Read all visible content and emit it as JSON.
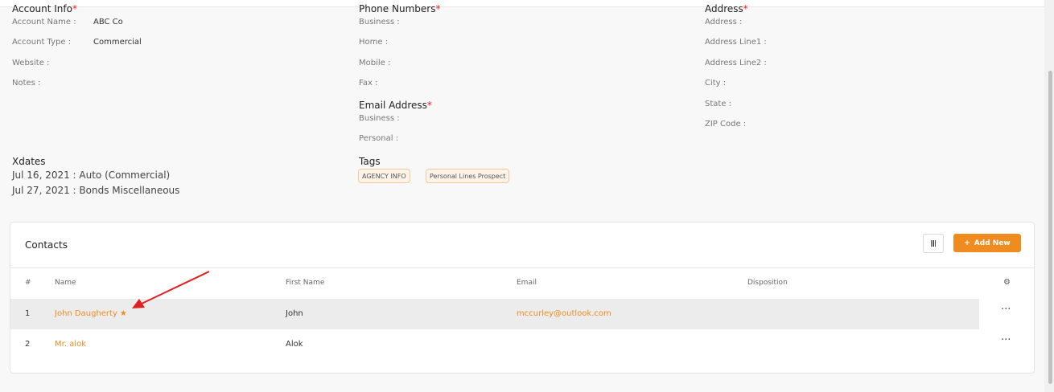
{
  "account_info": {
    "title": "Account Info",
    "required_mark": "*",
    "fields": [
      {
        "label": "Account Name :",
        "value": "ABC Co"
      },
      {
        "label": "Account Type :",
        "value": "Commercial"
      },
      {
        "label": "Website :",
        "value": ""
      },
      {
        "label": "Notes :",
        "value": ""
      }
    ]
  },
  "phone_numbers": {
    "title": "Phone Numbers",
    "required_mark": "*",
    "fields": [
      "Business :",
      "Home :",
      "Mobile :",
      "Fax :"
    ]
  },
  "email_address": {
    "title": "Email Address",
    "required_mark": "*",
    "fields": [
      "Business :",
      "Personal :"
    ]
  },
  "address": {
    "title": "Address",
    "required_mark": "*",
    "fields": [
      "Address :",
      "Address Line1 :",
      "Address Line2 :",
      "City :",
      "State :",
      "ZIP Code :"
    ]
  },
  "xdates": {
    "title": "Xdates",
    "items": [
      "Jul 16, 2021 : Auto (Commercial)",
      "Jul 27, 2021 : Bonds Miscellaneous"
    ]
  },
  "tags": {
    "title": "Tags",
    "items": [
      "AGENCY INFO",
      "Personal Lines Prospect"
    ]
  },
  "contacts": {
    "title": "Contacts",
    "add_button_label": "Add New",
    "columns": [
      "#",
      "Name",
      "First Name",
      "Email",
      "Disposition"
    ],
    "rows": [
      {
        "num": "1",
        "name": "John Daugherty",
        "first_name": "John",
        "email": "mccurley@outlook.com",
        "disposition": "",
        "starred": true
      },
      {
        "num": "2",
        "name": "Mr. alok",
        "first_name": "Alok",
        "email": "",
        "disposition": "",
        "starred": false
      }
    ]
  },
  "icons": {
    "star": "star-icon",
    "gear": "gear-icon",
    "columns": "columns-icon",
    "plus": "plus-icon",
    "more": "more-horizontal-icon"
  },
  "colors": {
    "accent": "#f08c1f",
    "required": "#e02424",
    "annotation_arrow": "#e02020"
  }
}
